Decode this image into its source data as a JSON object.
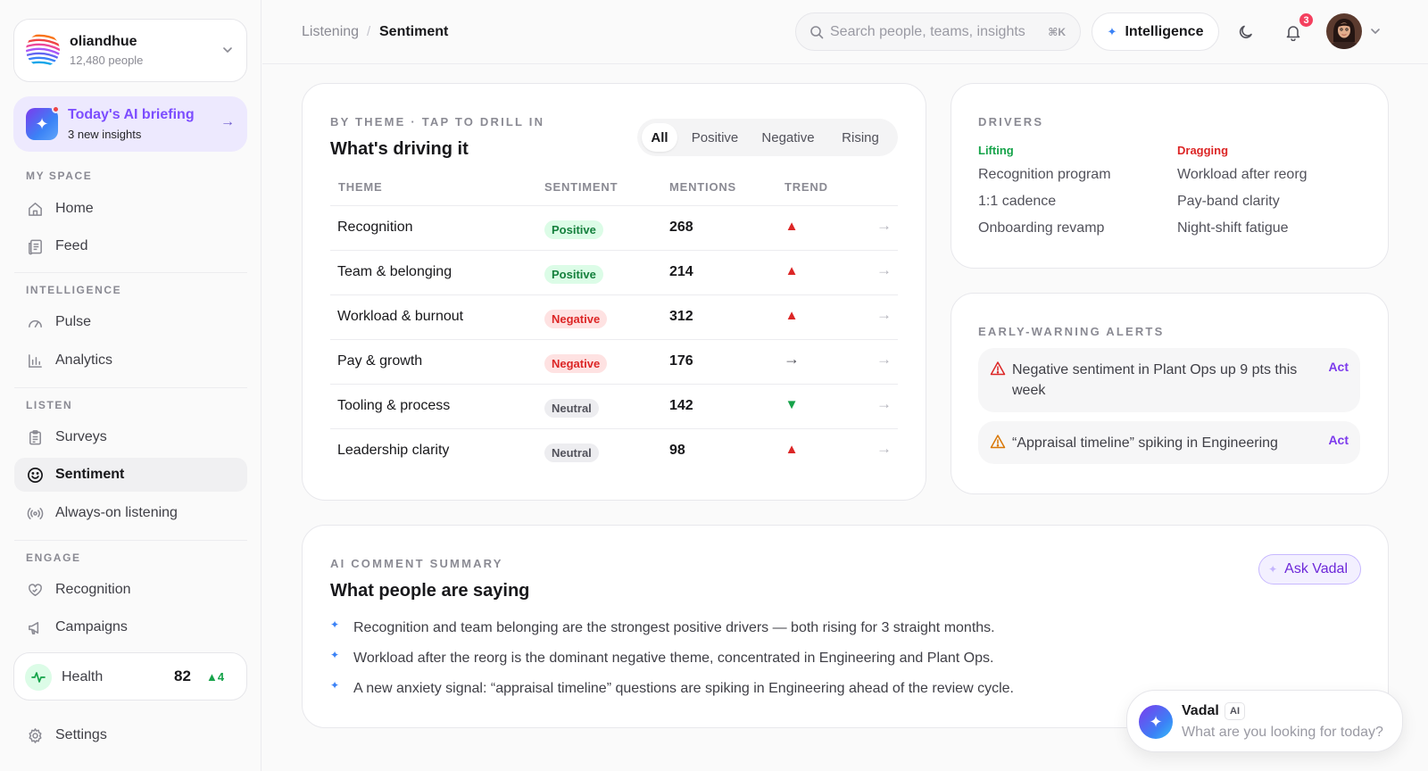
{
  "org": {
    "name": "oliandhue",
    "people": "12,480 people"
  },
  "briefing": {
    "title": "Today's AI briefing",
    "subtitle": "3 new insights"
  },
  "nav": {
    "sections": {
      "my_space": "MY SPACE",
      "intelligence": "INTELLIGENCE",
      "listen": "LISTEN",
      "engage": "ENGAGE"
    },
    "items": [
      {
        "label": "Home",
        "icon": "home-icon"
      },
      {
        "label": "Feed",
        "icon": "feed-icon"
      },
      {
        "label": "Pulse",
        "icon": "gauge-icon"
      },
      {
        "label": "Analytics",
        "icon": "bar-chart-icon"
      },
      {
        "label": "Surveys",
        "icon": "clipboard-icon"
      },
      {
        "label": "Sentiment",
        "icon": "smile-icon",
        "active": true
      },
      {
        "label": "Always-on listening",
        "icon": "broadcast-icon"
      },
      {
        "label": "Recognition",
        "icon": "heart-hand-icon"
      },
      {
        "label": "Campaigns",
        "icon": "megaphone-icon"
      }
    ],
    "settings": "Settings"
  },
  "health": {
    "label": "Health",
    "score": "82",
    "delta": "▲4"
  },
  "breadcrumb": {
    "parent": "Listening",
    "separator": "/",
    "current": "Sentiment"
  },
  "search": {
    "placeholder": "Search people, teams, insights",
    "shortcut": "⌘K"
  },
  "intelligence_button": {
    "label": "Intelligence"
  },
  "notifications": {
    "count": "3"
  },
  "themes": {
    "eyebrow": "BY THEME · TAP TO DRILL IN",
    "title": "What's driving it",
    "filters": [
      "All",
      "Positive",
      "Negative",
      "Rising"
    ],
    "columns": [
      "THEME",
      "SENTIMENT",
      "MENTIONS",
      "TREND"
    ],
    "rows": [
      {
        "theme": "Recognition",
        "sentiment": "Positive",
        "mentions": "268",
        "trend": "▲"
      },
      {
        "theme": "Team & belonging",
        "sentiment": "Positive",
        "mentions": "214",
        "trend": "▲"
      },
      {
        "theme": "Workload & burnout",
        "sentiment": "Negative",
        "mentions": "312",
        "trend": "▲"
      },
      {
        "theme": "Pay & growth",
        "sentiment": "Negative",
        "mentions": "176",
        "trend": "→"
      },
      {
        "theme": "Tooling & process",
        "sentiment": "Neutral",
        "mentions": "142",
        "trend": "▼"
      },
      {
        "theme": "Leadership clarity",
        "sentiment": "Neutral",
        "mentions": "98",
        "trend": "▲"
      }
    ],
    "row_action": "→"
  },
  "drivers": {
    "eyebrow": "DRIVERS",
    "lifting_label": "Lifting",
    "dragging_label": "Dragging",
    "lifting": [
      "Recognition program",
      "1:1 cadence",
      "Onboarding revamp"
    ],
    "dragging": [
      "Workload after reorg",
      "Pay-band clarity",
      "Night-shift fatigue"
    ]
  },
  "alerts": {
    "eyebrow": "EARLY-WARNING ALERTS",
    "items": [
      {
        "text": "Negative sentiment in Plant Ops up 9 pts this week",
        "action": "Act",
        "color": "#dc2626"
      },
      {
        "text": "“Appraisal timeline” spiking in Engineering",
        "action": "Act",
        "color": "#d97706"
      }
    ]
  },
  "summary": {
    "eyebrow": "AI COMMENT SUMMARY",
    "title": "What people are saying",
    "ask_label": "Ask Vadal",
    "bullets": [
      "Recognition and team belonging are the strongest positive drivers — both rising for 3 straight months.",
      "Workload after the reorg is the dominant negative theme, concentrated in Engineering and Plant Ops.",
      "A new anxiety signal: “appraisal timeline” questions are spiking in Engineering ahead of the review cycle."
    ]
  },
  "assistant": {
    "name": "Vadal",
    "tag": "AI",
    "prompt": "What are you looking for today?"
  }
}
